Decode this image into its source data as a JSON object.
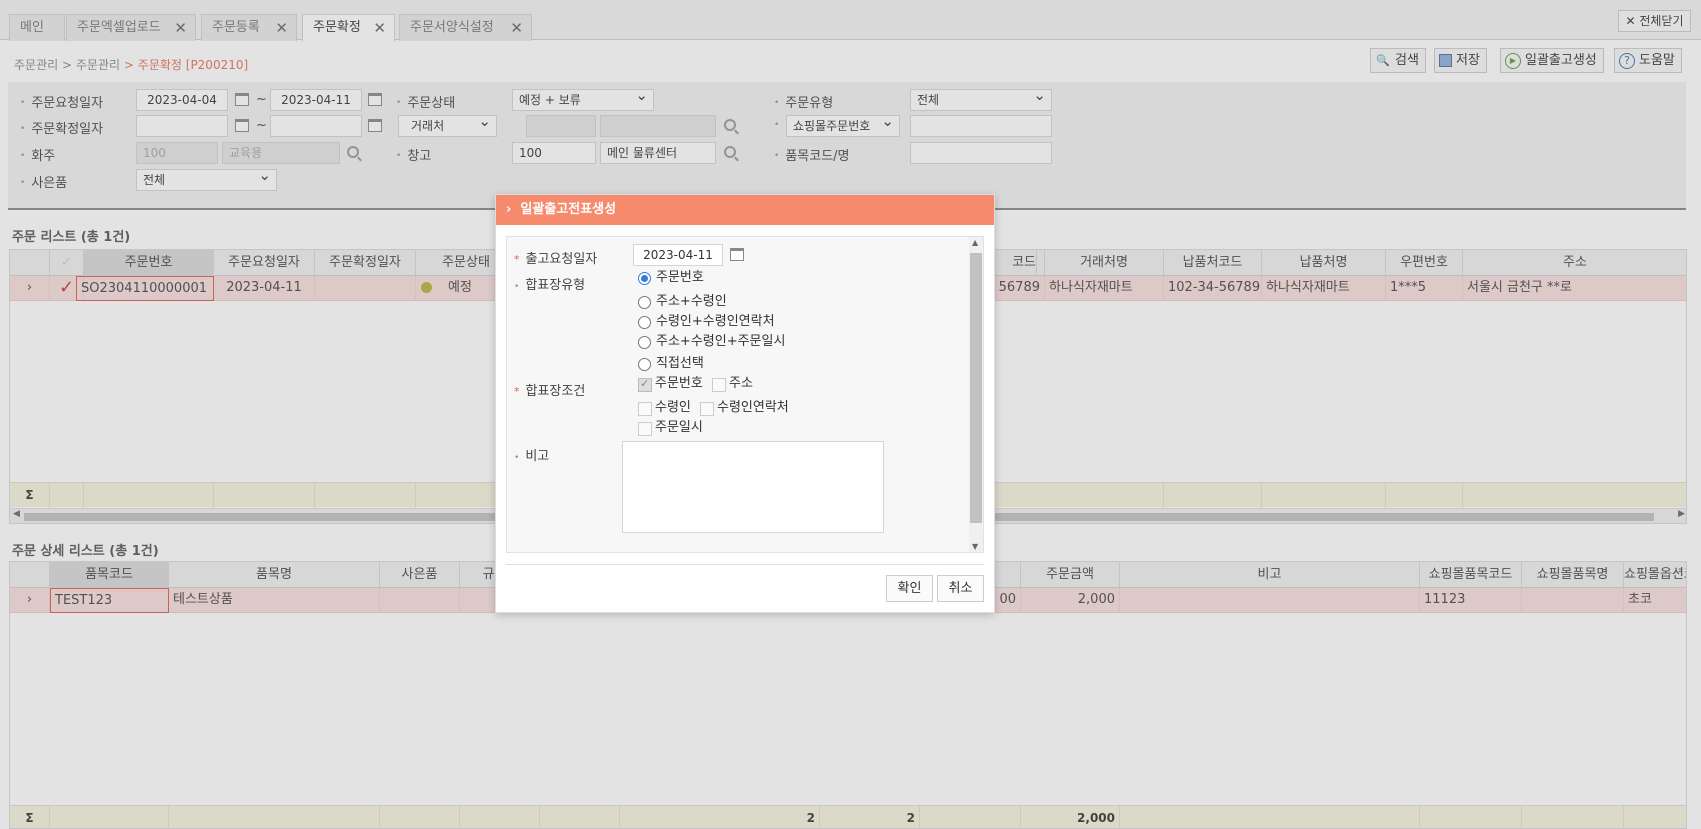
{
  "tabs": [
    {
      "label": "메인",
      "closable": false
    },
    {
      "label": "주문엑셀업로드",
      "closable": true
    },
    {
      "label": "주문등록",
      "closable": true
    },
    {
      "label": "주문확정",
      "closable": true,
      "active": true
    },
    {
      "label": "주문서양식설정",
      "closable": true
    }
  ],
  "close_all": "전체닫기",
  "breadcrumb": {
    "l1": "주문관리",
    "sep": ">",
    "l2": "주문관리",
    "current": "주문확정 [P200210]"
  },
  "toolbar": {
    "search": "검색",
    "save": "저장",
    "bulk_ship": "일괄출고생성",
    "help": "도움말"
  },
  "search": {
    "order_req_date_label": "주문요청일자",
    "order_req_date_from": "2023-04-04",
    "order_req_date_to": "2023-04-11",
    "tilde": "~",
    "order_conf_date_label": "주문확정일자",
    "owner_label": "화주",
    "owner_code": "100",
    "owner_name": "교육용",
    "gift_label": "사은품",
    "gift_value": "전체",
    "status_label": "주문상태",
    "status_value": "예정 + 보류",
    "partner_select": "거래처",
    "warehouse_label": "창고",
    "warehouse_code": "100",
    "warehouse_name": "메인 물류센터",
    "type_label": "주문유형",
    "type_value": "전체",
    "mall_select": "쇼핑몰주문번호",
    "item_label": "품목코드/명"
  },
  "order_list": {
    "title": "주문 리스트 (총 1건)",
    "headers": [
      "주문번호",
      "주문요청일자",
      "주문확정일자",
      "주문상태",
      "코드",
      "거래처명",
      "납품처코드",
      "납품처명",
      "우편번호",
      "주소"
    ],
    "row": {
      "order_no": "SO2304110000001",
      "req_date": "2023-04-11",
      "conf_date": "",
      "status": "예정",
      "code_tail": "56789",
      "partner": "하나식자재마트",
      "dest_code": "102-34-56789",
      "dest_name": "하나식자재마트",
      "zip": "1***5",
      "address": "서울시 금천구 **로"
    },
    "sum_icon": "Σ"
  },
  "detail_list": {
    "title": "주문 상세 리스트 (총 1건)",
    "headers": [
      "품목코드",
      "품목명",
      "사은품",
      "규격",
      "주문금액",
      "비고",
      "쇼핑몰품목코드",
      "쇼핑몰품목명",
      "쇼핑몰옵션코드"
    ],
    "row": {
      "item_code": "TEST123",
      "item_name": "테스트상품",
      "hidden_tail": "00",
      "amount": "2,000",
      "mall_item_code": "11123",
      "mall_option": "초코"
    },
    "sum": {
      "icon": "Σ",
      "q1": "2",
      "q2": "2",
      "amount": "2,000"
    }
  },
  "modal": {
    "title": "일괄출고전표생성",
    "ship_date_label": "출고요청일자",
    "ship_date": "2023-04-11",
    "merge_type_label": "합표장유형",
    "merge_types": [
      "주문번호",
      "주소+수령인",
      "수령인+수령인연락처",
      "주소+수령인+주문일시",
      "직접선택"
    ],
    "merge_cond_label": "합표장조건",
    "conditions": [
      "주문번호",
      "주소",
      "수령인",
      "수령인연락처",
      "주문일시"
    ],
    "note_label": "비고",
    "confirm": "확인",
    "cancel": "취소"
  },
  "colors": {
    "accent": "#f58b6c",
    "row_highlight": "#f9dede",
    "sum_row": "#f5f3dd",
    "breadcrumb_current": "#e8705a"
  }
}
